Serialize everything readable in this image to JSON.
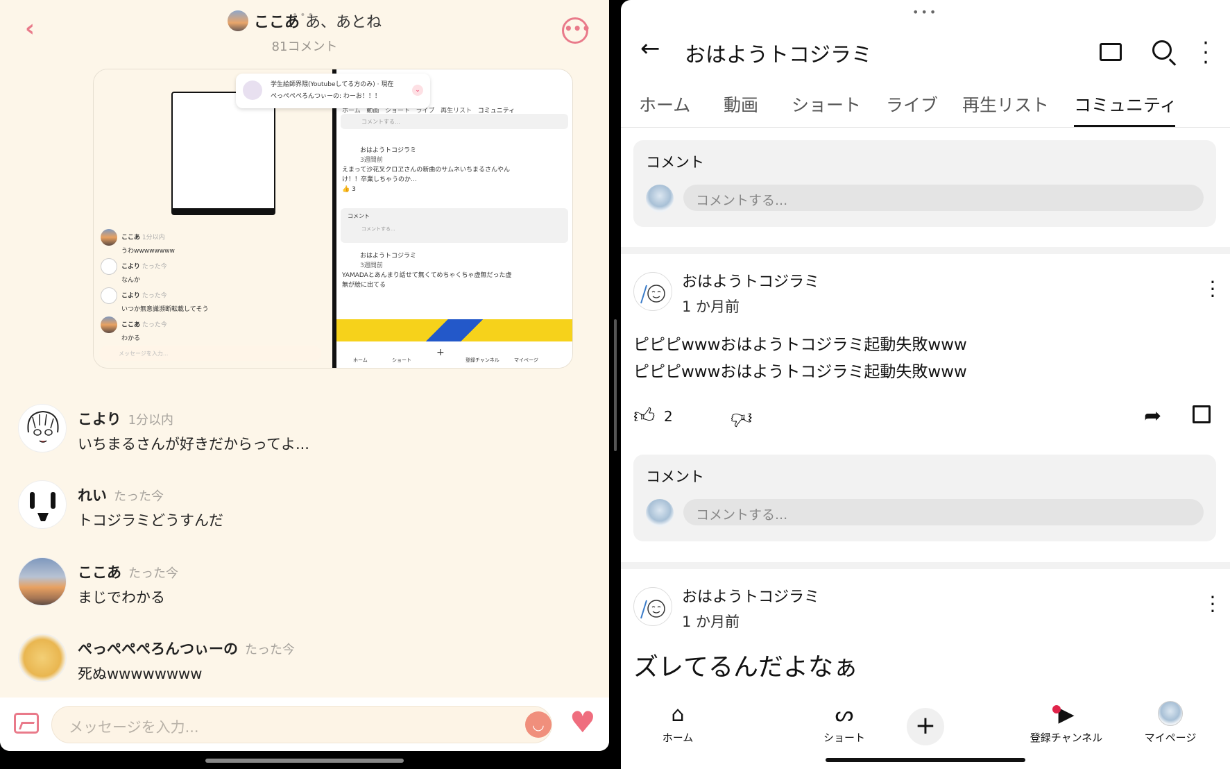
{
  "chat": {
    "header": {
      "name": "ここあ",
      "subtitle": "あ、あとね",
      "comment_count": "81コメント"
    },
    "preview": {
      "notification_title": "学生絵師界隈(Youtubeしてる方のみ) · 現在",
      "notification_text": "ぺっぺぺぺろんつぃーの: わーお！！！",
      "left_messages": [
        {
          "name": "ここあ",
          "time": "1分以内",
          "text": "うわwwwwwwww"
        },
        {
          "name": "こより",
          "time": "たった今",
          "text": "なんか"
        },
        {
          "name": "こより",
          "time": "たった今",
          "text": "いつか無意識瀕断転載してそう"
        },
        {
          "name": "ここあ",
          "time": "たった今",
          "text": "わかる"
        }
      ],
      "input_placeholder": "メッセージを入力...",
      "yt_tabs": [
        "ホーム",
        "動画",
        "ショート",
        "ライブ",
        "再生リスト",
        "コミュニティ"
      ],
      "yt_comment_placeholder": "コメントする...",
      "yt_posts": [
        {
          "author": "おはようトコジラミ",
          "ago": "3週間前",
          "text": "えまって沙花叉クロヱさんの新曲のサムネいちまるさんやんけ！！卒業しちゃうのか…",
          "likes": "3"
        },
        {
          "author": "おはようトコジラミ",
          "ago": "3週間前",
          "text": "YAMADAとあんまり話せて無くてめちゃくちゃ虚無だった虚無が絵に出てる"
        }
      ],
      "yt_comment_label": "コメント",
      "yt_nav": [
        "ホーム",
        "ショート",
        "登録チャンネル",
        "マイページ"
      ]
    },
    "messages": [
      {
        "name": "こより",
        "time": "1分以内",
        "text": "いちまるさんが好きだからってよ..."
      },
      {
        "name": "れい",
        "time": "たった今",
        "text": "トコジラミどうすんだ"
      },
      {
        "name": "ここあ",
        "time": "たった今",
        "text": "まじでわかる"
      },
      {
        "name": "ぺっぺぺぺろんつぃーの",
        "time": "たった今",
        "text": "死ぬwwwwwwww"
      }
    ],
    "input_placeholder": "メッセージを入力..."
  },
  "youtube": {
    "title": "おはようトコジラミ",
    "tabs": [
      "ホーム",
      "動画",
      "ショート",
      "ライブ",
      "再生リスト",
      "コミュニティ"
    ],
    "active_tab": "コミュニティ",
    "comment_label": "コメント",
    "comment_placeholder": "コメントする...",
    "posts": [
      {
        "author": "おはようトコジラミ",
        "ago": "1 か月前",
        "lines": [
          "ピピピwwwおはようトコジラミ起動失敗www",
          "ピピピwwwおはようトコジラミ起動失敗www"
        ],
        "likes": "2"
      },
      {
        "author": "おはようトコジラミ",
        "ago": "1 か月前",
        "lines": [
          "ズレてるんだよなぁ"
        ]
      }
    ],
    "nav": {
      "home": "ホーム",
      "shorts": "ショート",
      "subscriptions": "登録チャンネル",
      "mypage": "マイページ"
    }
  },
  "colors": {
    "chat_bg": "#fdf6e9",
    "chat_accent": "#e97a8a",
    "yt_text": "#111111",
    "yt_badge": "#e0244a"
  }
}
